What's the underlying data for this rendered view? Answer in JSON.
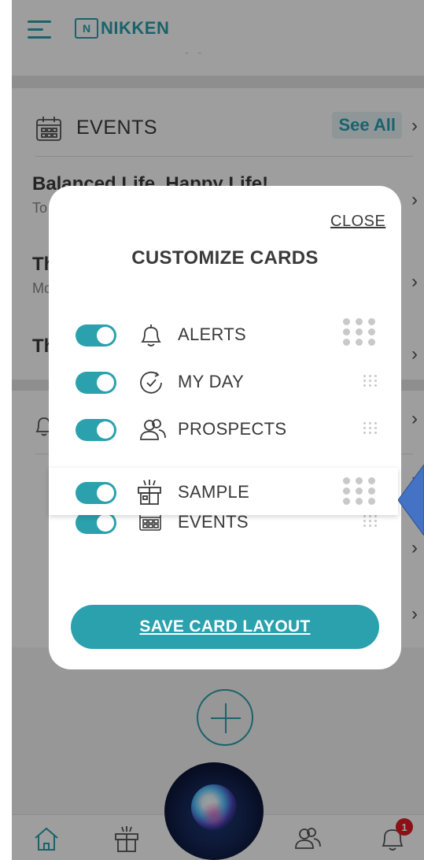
{
  "app": {
    "logo_mark": "N",
    "logo_text": "NIKKEN",
    "topbar_sub": "- -"
  },
  "events": {
    "title": "EVENTS",
    "see_all": "See All",
    "rows": [
      {
        "title": "Balanced Life, Happy Life!",
        "sub": "To"
      },
      {
        "title": "Th",
        "sub": "Mo"
      },
      {
        "title": "Th",
        "sub": ""
      }
    ]
  },
  "modal": {
    "close": "CLOSE",
    "title": "CUSTOMIZE CARDS",
    "cards": [
      {
        "label": "ALERTS",
        "icon": "bell-icon",
        "enabled": true
      },
      {
        "label": "MY DAY",
        "icon": "clock-icon",
        "enabled": true
      },
      {
        "label": "PROSPECTS",
        "icon": "people-icon",
        "enabled": true
      },
      {
        "label": "EVENTS",
        "icon": "calendar-icon",
        "enabled": true
      }
    ],
    "dragging_card": {
      "label": "SAMPLE",
      "icon": "gift-icon",
      "enabled": true
    },
    "save_label": "SAVE CARD LAYOUT"
  },
  "bottom_nav": {
    "items": [
      "home-icon",
      "gift-icon",
      "assistant-orb",
      "people-icon",
      "bell-icon"
    ],
    "notification_count": "1"
  },
  "colors": {
    "accent": "#2aa1ad",
    "badge": "#e31b23",
    "pointer": "#4472c4"
  }
}
